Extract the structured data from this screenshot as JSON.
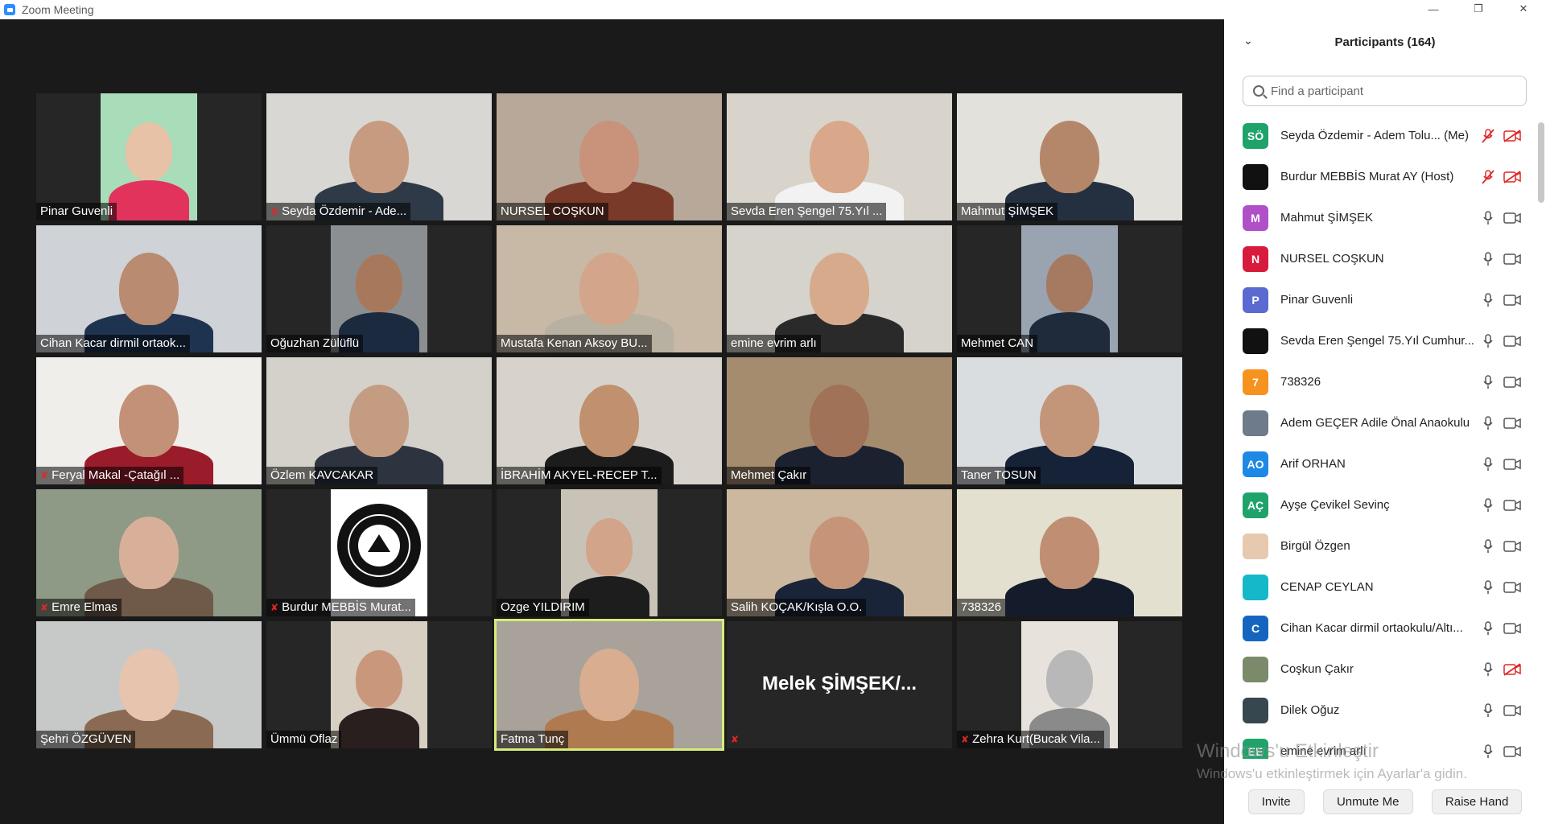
{
  "window": {
    "title": "Zoom Meeting",
    "controls": [
      "minimize-icon",
      "restore-icon",
      "close-icon"
    ]
  },
  "gallery": {
    "tiles": [
      {
        "name": "Pinar Guvenli",
        "muted": false
      },
      {
        "name": "Seyda Özdemir - Ade...",
        "muted": true
      },
      {
        "name": "NURSEL COŞKUN",
        "muted": false
      },
      {
        "name": "Sevda Eren Şengel 75.Yıl ...",
        "muted": false
      },
      {
        "name": "Mahmut ŞİMŞEK",
        "muted": false
      },
      {
        "name": "Cihan Kacar dirmil ortaok...",
        "muted": false
      },
      {
        "name": "Oğuzhan Zülüflü",
        "muted": false
      },
      {
        "name": "Mustafa Kenan Aksoy BU...",
        "muted": false
      },
      {
        "name": "emine evrim arlı",
        "muted": false
      },
      {
        "name": "Mehmet CAN",
        "muted": false
      },
      {
        "name": "Feryal Makal  -Çatağıl ...",
        "muted": true
      },
      {
        "name": "Özlem KAVCAKAR",
        "muted": false
      },
      {
        "name": "İBRAHİM AKYEL-RECEP T...",
        "muted": false
      },
      {
        "name": "Mehmet Çakır",
        "muted": false
      },
      {
        "name": "Taner TOSUN",
        "muted": false
      },
      {
        "name": "Emre Elmas",
        "muted": true
      },
      {
        "name": "Burdur MEBBİS Murat...",
        "muted": true
      },
      {
        "name": "Ozge YILDIRIM",
        "muted": false
      },
      {
        "name": "Salih KOÇAK/Kışla O.O.",
        "muted": false
      },
      {
        "name": "738326",
        "muted": false
      },
      {
        "name": "Şehri ÖZGÜVEN",
        "muted": false
      },
      {
        "name": "Ümmü Oflaz",
        "muted": false
      },
      {
        "name": "Fatma Tunç",
        "muted": false,
        "active_speaker": true
      },
      {
        "name": "",
        "muted": true,
        "display_name": "Melek  ŞİMŞEK/..."
      },
      {
        "name": "Zehra Kurt(Bucak Vila...",
        "muted": true
      }
    ]
  },
  "participants": {
    "title": "Participants (164)",
    "search_placeholder": "Find a participant",
    "list": [
      {
        "initials": "SÖ",
        "color": "#20a36b",
        "name": "Seyda Özdemir - Adem Tolu...",
        "suffix": "(Me)",
        "mic": "muted",
        "video": "off"
      },
      {
        "initials": "",
        "color": "#111111",
        "name": "Burdur MEBBİS Murat AY (Host)",
        "suffix": "",
        "mic": "muted",
        "video": "off"
      },
      {
        "initials": "M",
        "color": "#b050c8",
        "name": "Mahmut ŞİMŞEK",
        "suffix": "",
        "mic": "on",
        "video": "on"
      },
      {
        "initials": "N",
        "color": "#d81b3c",
        "name": "NURSEL COŞKUN",
        "suffix": "",
        "mic": "on",
        "video": "on"
      },
      {
        "initials": "P",
        "color": "#5b6ad0",
        "name": "Pinar Guvenli",
        "suffix": "",
        "mic": "on",
        "video": "on"
      },
      {
        "initials": "",
        "color": "#111111",
        "name": "Sevda Eren Şengel 75.Yıl Cumhur...",
        "suffix": "",
        "mic": "on",
        "video": "on"
      },
      {
        "initials": "7",
        "color": "#f6921e",
        "name": "738326",
        "suffix": "",
        "mic": "on",
        "video": "on"
      },
      {
        "initials": "",
        "color": "#6d7b8a",
        "name": "Adem GEÇER Adile Önal Anaokulu",
        "suffix": "",
        "mic": "on",
        "video": "on"
      },
      {
        "initials": "AO",
        "color": "#1e88e5",
        "name": "Arif ORHAN",
        "suffix": "",
        "mic": "on",
        "video": "on"
      },
      {
        "initials": "AÇ",
        "color": "#20a36b",
        "name": "Ayşe Çevikel Sevinç",
        "suffix": "",
        "mic": "on",
        "video": "on"
      },
      {
        "initials": "",
        "color": "#e7c9b0",
        "name": "Birgül Özgen",
        "suffix": "",
        "mic": "on",
        "video": "on"
      },
      {
        "initials": "",
        "color": "#14b8c8",
        "name": "CENAP CEYLAN",
        "suffix": "",
        "mic": "on",
        "video": "on"
      },
      {
        "initials": "C",
        "color": "#1565c0",
        "name": "Cihan Kacar dirmil ortaokulu/Altı...",
        "suffix": "",
        "mic": "on",
        "video": "on"
      },
      {
        "initials": "",
        "color": "#7a8a6a",
        "name": "Coşkun Çakır",
        "suffix": "",
        "mic": "on",
        "video": "off"
      },
      {
        "initials": "",
        "color": "#37474f",
        "name": "Dilek Oğuz",
        "suffix": "",
        "mic": "on",
        "video": "on"
      },
      {
        "initials": "EE",
        "color": "#20a36b",
        "name": "emine evrim arlı",
        "suffix": "",
        "mic": "on",
        "video": "on"
      }
    ],
    "footer": {
      "invite": "Invite",
      "unmute": "Unmute Me",
      "raise_hand": "Raise Hand"
    }
  },
  "watermark": {
    "line1": "Windows'u Etkinleştir",
    "line2": "Windows'u etkinleştirmek için Ayarlar'a gidin."
  }
}
